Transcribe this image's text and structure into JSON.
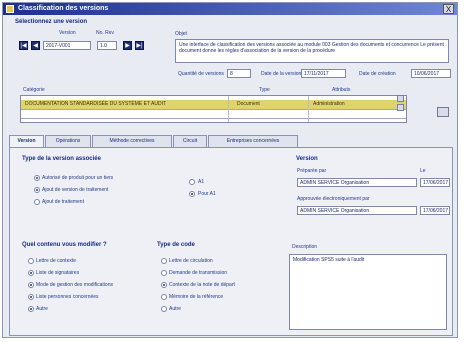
{
  "window": {
    "title": "Classification des versions",
    "close_label": "X"
  },
  "selection": {
    "heading": "Sélectionnez une version",
    "ver_label": "Version",
    "rev_label": "No. Rev",
    "version_value": "2017-V001",
    "rev_value": "1.0",
    "nav_first": "|◀",
    "nav_prev": "◀",
    "nav_next": "▶",
    "nav_last": "▶|"
  },
  "objet": {
    "label": "Objet",
    "text": "Une interface de classification des versions associée au module 003 Gestion des documents et concurrence Le présent document donne les règles d'association de la version de la procédure"
  },
  "meta": {
    "qty_label": "Quantité de versions",
    "qty_value": "8",
    "date_label": "Date de la version",
    "date_value": "17/11/2017",
    "date2_label": "Date de création",
    "date2_value": "10/06/2017"
  },
  "table": {
    "col1": "Catégorie",
    "col2": "Type",
    "col3": "Attributs",
    "rows": [
      {
        "a": "DOCUMENTATION STANDARDISÉE DU SYSTÈME ET AUDIT",
        "b": "Document",
        "c": "Administration"
      }
    ]
  },
  "tabs": [
    "Version",
    "Opérations",
    "Méthode correctives",
    "Circuit",
    "Entreprises concernées"
  ],
  "version_type": {
    "heading": "Type de la version associée",
    "options": [
      "Autorisé de produit pour un tiers",
      "Ajout de version de traitement",
      "Ajout de traitement"
    ],
    "option_a": "A1",
    "option_b": "Pour A1"
  },
  "version_box": {
    "heading": "Version",
    "field1_label": "Préparée par",
    "field1_value": "ADMIN SERVICE Organisation",
    "field1_date": "17/06/2017",
    "field2_label": "Approuvée électroniquement par",
    "field2_value": "ADMIN SERVICE Organisation",
    "field2_date": "17/06/2017",
    "date_header": "Le"
  },
  "modify": {
    "heading": "Quel contenu vous modifier ?",
    "options": [
      "Lettre de contexte",
      "Liste de signataires",
      "Mode de gestion des modifications",
      "Liste personnes concernées",
      "Autre"
    ]
  },
  "send": {
    "heading": "Type de code",
    "options": [
      "Lettre de circulation",
      "Demande de transmission",
      "Contexte de la note de départ",
      "Mémoire de la référence",
      "Autre"
    ]
  },
  "description": {
    "label": "Description",
    "text": "Modification SPS5 suite à l'audit"
  }
}
